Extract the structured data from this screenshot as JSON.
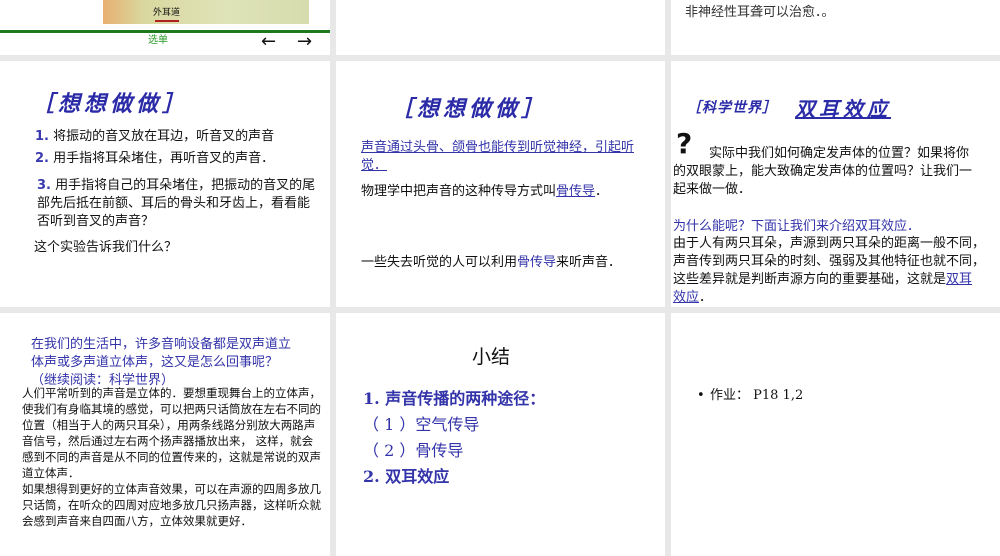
{
  "slides": [
    {
      "img_label": "外耳道",
      "menu_label": "选单",
      "prev": "←",
      "next": "→"
    },
    {},
    {
      "text": "非神经性耳聋可以治愈．。"
    },
    {
      "title": "［想想做做］",
      "item1_num": "1.",
      "item1": "将振动的音叉放在耳边，听音叉的声音",
      "item2_num": "2.",
      "item2": "用手指将耳朵堵住，再听音叉的声音．",
      "item3_num": "3.",
      "item3": "用手指将自己的耳朵堵住，把振动的音叉的尾部先后抵在前额、耳后的骨头和牙齿上，看看能否听到音叉的声音？",
      "question": "这个实验告诉我们什么？"
    },
    {
      "title": "［想想做做］",
      "link1": "声音通过头骨、颌骨也能传到听觉神经，引起听觉．",
      "p2_pre": "物理学中把声音的这种传导方式叫",
      "p2_link": "骨传导",
      "p2_post": "．",
      "p3_pre": "一些失去听觉的人可以利用",
      "p3_link": "骨传导",
      "p3_post": "来听声音．"
    },
    {
      "title_bracket": "［科学世界］",
      "title_main": "双耳效应",
      "qmark": "?",
      "p1": "实际中我们如何确定发声体的位置？如果将你的双眼蒙上，能大致确定发声体的位置吗？让我们一起来做一做．",
      "p2": "为什么能呢？下面让我们来介绍双耳效应．",
      "p3_pre": "由于人有两只耳朵，声源到两只耳朵的距离一般不同，声音传到两只耳朵的时刻、强弱及其他特征也就不同，这些差异就是判断声源方向的重要基础，这就是",
      "p3_link": "双耳效应",
      "p3_post": "．"
    },
    {
      "intro": "在我们的生活中，许多音响设备都是双声道立体声或多声道立体声，这又是怎么回事呢？（继续阅读：科学世界）",
      "body1": "人们平常听到的声音是立体的．要想重现舞台上的立体声，使我们有身临其境的感觉，可以把两只话筒放在左右不同的位置（相当于人的两只耳朵），用两条线路分别放大两路声音信号，然后通过左右两个扬声器播放出来， 这样，就会感到不同的声音是从不同的位置传来的，这就是常说的双声道立体声．",
      "body2": "如果想得到更好的立体声音效果，可以在声源的四周多放几只话筒，在听众的四周对应地多放几只扬声器，这样听众就会感到声音来自四面八方，立体效果就更好．"
    },
    {
      "title": "小结",
      "l1": "1. 声音传播的两种途径：",
      "l2": "（ 1 ）空气传导",
      "l3": "（ 2 ）骨传导",
      "l4": "2. 双耳效应"
    },
    {
      "bullet": "•",
      "homework": "作业： P18   1,2"
    }
  ]
}
